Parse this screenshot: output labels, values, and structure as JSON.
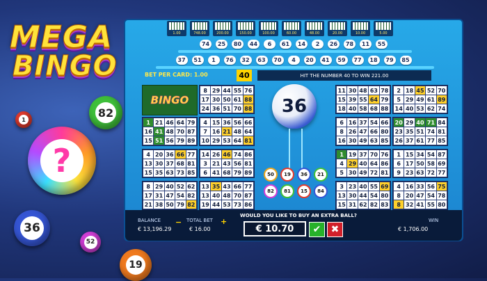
{
  "logo": {
    "line1": "MEGA",
    "line2": "BINGO"
  },
  "decor_balls": [
    "1",
    "82",
    "?",
    "36",
    "52",
    "19"
  ],
  "paytable": [
    {
      "value": "1.00"
    },
    {
      "value": "748.00"
    },
    {
      "value": "200.00"
    },
    {
      "value": "150.00"
    },
    {
      "value": "100.00"
    },
    {
      "value": "60.00"
    },
    {
      "value": "48.00"
    },
    {
      "value": "20.00"
    },
    {
      "value": "10.00"
    },
    {
      "value": "5.00"
    }
  ],
  "drawn_balls_row1": [
    "74",
    "25",
    "80",
    "44",
    "6",
    "61",
    "14",
    "2",
    "26",
    "78",
    "11",
    "55"
  ],
  "drawn_balls_row2": [
    "37",
    "51",
    "1",
    "76",
    "32",
    "63",
    "70",
    "4",
    "20",
    "41",
    "59",
    "77",
    "18",
    "79",
    "85"
  ],
  "info": {
    "bet_per_card": "BET PER CARD: 1.00",
    "target_number": "40",
    "hit_text": "HIT THE NUMBER 40 TO WIN 221.00"
  },
  "bingo_card_label": "BINGO",
  "current_ball": "36",
  "tray_balls": [
    "50",
    "19",
    "36",
    "21",
    "82",
    "81",
    "15",
    "84"
  ],
  "cards": [
    {
      "id": "c1",
      "cells": [
        "8",
        "29",
        "44",
        "55",
        "76",
        "17",
        "30",
        "50",
        "61",
        "88",
        "24",
        "36",
        "51",
        "70",
        "88"
      ],
      "marks": [
        0,
        0,
        0,
        0,
        0,
        0,
        0,
        0,
        0,
        1,
        0,
        0,
        0,
        0,
        1
      ]
    },
    {
      "id": "c2",
      "cells": [
        "11",
        "30",
        "48",
        "63",
        "78",
        "15",
        "39",
        "55",
        "64",
        "79",
        "18",
        "40",
        "58",
        "68",
        "88"
      ],
      "marks": [
        0,
        0,
        0,
        0,
        0,
        0,
        0,
        0,
        1,
        0,
        0,
        0,
        0,
        0,
        0
      ]
    },
    {
      "id": "c3",
      "cells": [
        "2",
        "18",
        "45",
        "52",
        "70",
        "5",
        "29",
        "49",
        "61",
        "89",
        "14",
        "40",
        "53",
        "62",
        "74"
      ],
      "marks": [
        0,
        0,
        1,
        0,
        0,
        0,
        0,
        0,
        0,
        1,
        0,
        0,
        0,
        0,
        0
      ]
    },
    {
      "id": "c4",
      "cells": [
        "1",
        "21",
        "46",
        "64",
        "79",
        "16",
        "41",
        "48",
        "70",
        "87",
        "15",
        "51",
        "56",
        "79",
        "89"
      ],
      "marks": [
        2,
        0,
        0,
        0,
        0,
        0,
        2,
        0,
        0,
        0,
        0,
        2,
        0,
        0,
        0
      ]
    },
    {
      "id": "c5",
      "cells": [
        "4",
        "15",
        "36",
        "56",
        "66",
        "7",
        "16",
        "21",
        "48",
        "64",
        "10",
        "29",
        "53",
        "64",
        "81"
      ],
      "marks": [
        0,
        0,
        0,
        0,
        0,
        0,
        0,
        1,
        0,
        0,
        0,
        0,
        0,
        0,
        1
      ]
    },
    {
      "id": "c6",
      "cells": [
        "6",
        "16",
        "37",
        "54",
        "66",
        "8",
        "26",
        "47",
        "66",
        "80",
        "16",
        "30",
        "49",
        "63",
        "85"
      ],
      "marks": [
        0,
        0,
        0,
        0,
        0,
        0,
        0,
        0,
        0,
        0,
        0,
        0,
        0,
        0,
        0
      ]
    },
    {
      "id": "c7",
      "cells": [
        "20",
        "29",
        "40",
        "71",
        "84",
        "23",
        "35",
        "51",
        "74",
        "81",
        "26",
        "37",
        "61",
        "77",
        "85"
      ],
      "marks": [
        2,
        0,
        2,
        2,
        0,
        0,
        0,
        0,
        0,
        0,
        0,
        0,
        0,
        0,
        0
      ]
    },
    {
      "id": "c8",
      "cells": [
        "4",
        "20",
        "36",
        "66",
        "77",
        "13",
        "30",
        "37",
        "68",
        "81",
        "15",
        "35",
        "63",
        "73",
        "85"
      ],
      "marks": [
        0,
        0,
        0,
        1,
        0,
        0,
        0,
        0,
        0,
        0,
        0,
        0,
        0,
        0,
        0
      ]
    },
    {
      "id": "c9",
      "cells": [
        "14",
        "26",
        "46",
        "74",
        "86",
        "3",
        "21",
        "43",
        "56",
        "81",
        "6",
        "41",
        "68",
        "79",
        "89"
      ],
      "marks": [
        0,
        0,
        1,
        0,
        0,
        0,
        0,
        0,
        0,
        0,
        0,
        0,
        0,
        0,
        0
      ]
    },
    {
      "id": "c10",
      "cells": [
        "1",
        "19",
        "37",
        "70",
        "76",
        "4",
        "29",
        "40",
        "64",
        "86",
        "5",
        "30",
        "49",
        "72",
        "81"
      ],
      "marks": [
        2,
        0,
        0,
        0,
        0,
        0,
        1,
        0,
        0,
        0,
        0,
        0,
        0,
        0,
        0
      ]
    },
    {
      "id": "c11",
      "cells": [
        "1",
        "15",
        "34",
        "54",
        "87",
        "6",
        "17",
        "50",
        "58",
        "69",
        "9",
        "23",
        "63",
        "72",
        "77"
      ],
      "marks": [
        0,
        0,
        0,
        0,
        0,
        0,
        0,
        0,
        0,
        0,
        0,
        0,
        0,
        0,
        0
      ]
    },
    {
      "id": "c12",
      "cells": [
        "8",
        "29",
        "40",
        "52",
        "62",
        "17",
        "31",
        "47",
        "54",
        "82",
        "21",
        "38",
        "50",
        "79",
        "82"
      ],
      "marks": [
        0,
        0,
        0,
        0,
        0,
        0,
        0,
        0,
        0,
        0,
        0,
        0,
        0,
        0,
        1
      ]
    },
    {
      "id": "c13",
      "cells": [
        "13",
        "35",
        "43",
        "66",
        "77",
        "13",
        "40",
        "48",
        "70",
        "87",
        "19",
        "44",
        "53",
        "73",
        "86"
      ],
      "marks": [
        0,
        1,
        0,
        0,
        0,
        0,
        0,
        0,
        0,
        0,
        0,
        0,
        0,
        0,
        0
      ]
    },
    {
      "id": "c14",
      "cells": [
        "3",
        "23",
        "40",
        "55",
        "69",
        "13",
        "30",
        "44",
        "54",
        "80",
        "15",
        "31",
        "62",
        "82",
        "83"
      ],
      "marks": [
        0,
        0,
        0,
        0,
        1,
        0,
        0,
        0,
        0,
        0,
        0,
        0,
        0,
        0,
        0
      ]
    },
    {
      "id": "c15",
      "cells": [
        "4",
        "16",
        "33",
        "56",
        "75",
        "8",
        "20",
        "47",
        "54",
        "78",
        "8",
        "32",
        "41",
        "55",
        "80"
      ],
      "marks": [
        0,
        0,
        0,
        0,
        1,
        0,
        0,
        0,
        0,
        0,
        1,
        0,
        0,
        0,
        0
      ]
    }
  ],
  "bottom": {
    "balance_label": "BALANCE",
    "balance_value": "€ 13,196.29",
    "total_bet_label": "TOTAL BET",
    "total_bet_value": "€ 16.00",
    "minus": "−",
    "plus": "+",
    "question": "WOULD YOU LIKE TO BUY AN EXTRA BALL?",
    "extra_ball_price": "€ 10.70",
    "confirm": "✔",
    "cancel": "✖",
    "win_label": "WIN",
    "win_value": "€ 1,706.00"
  }
}
